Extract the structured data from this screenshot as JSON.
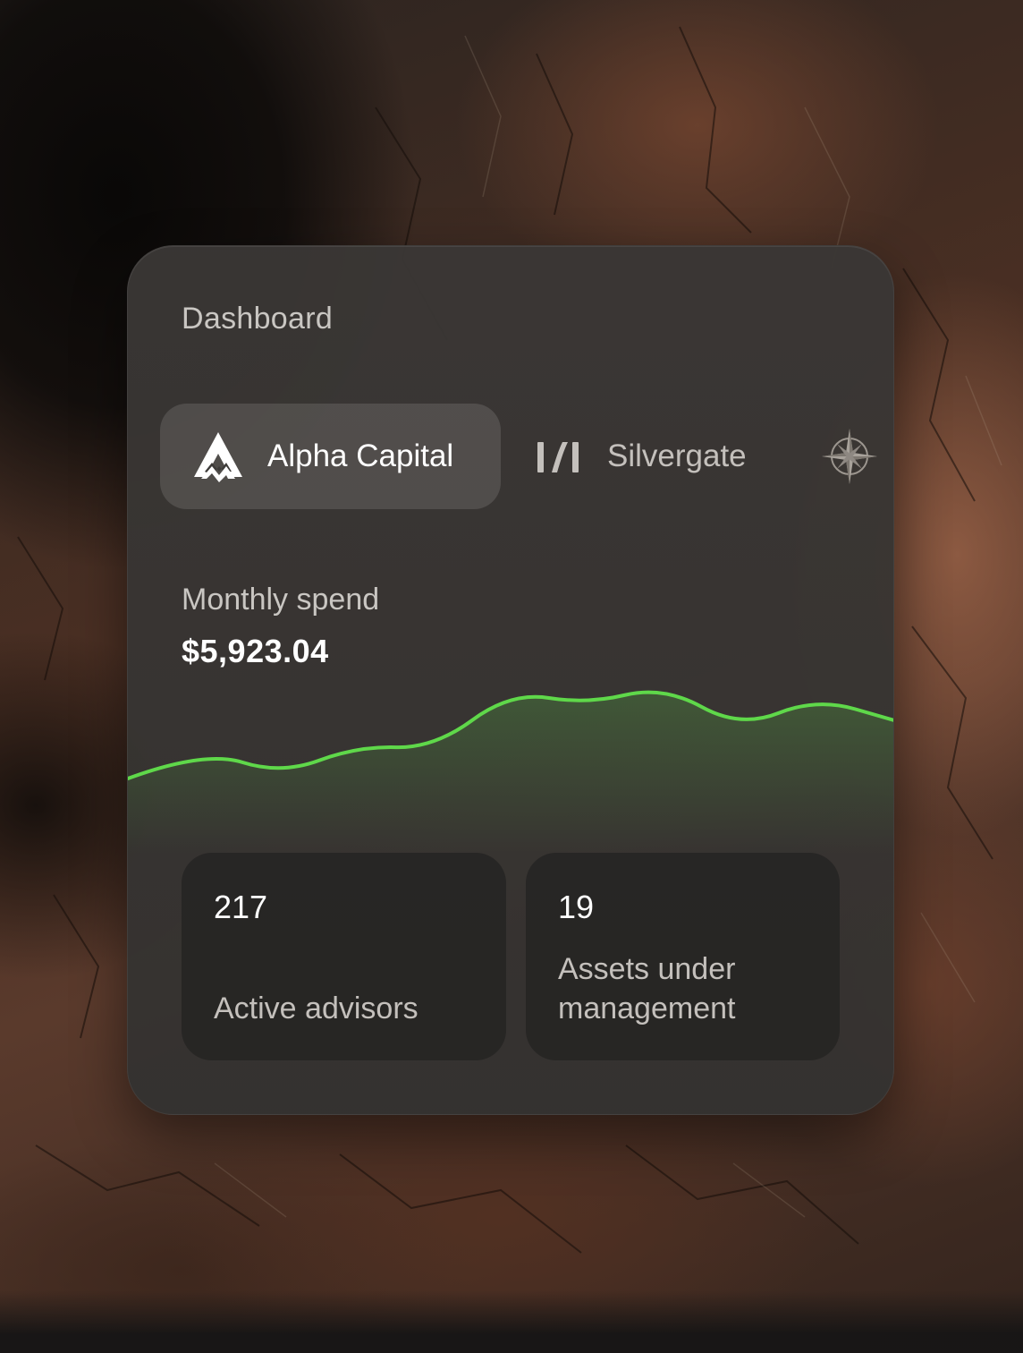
{
  "dashboard": {
    "title": "Dashboard"
  },
  "brands": [
    {
      "label": "Alpha Capital",
      "icon": "alpha-capital-logo-icon",
      "selected": true
    },
    {
      "label": "Silvergate",
      "icon": "silvergate-logo-icon",
      "selected": false
    },
    {
      "label": "",
      "icon": "compass-rose-logo-icon",
      "selected": false
    }
  ],
  "spend": {
    "label": "Monthly spend",
    "value": "$5,923.04"
  },
  "chart_data": {
    "type": "area",
    "values": [
      20,
      34,
      22,
      36,
      35,
      63,
      57,
      66,
      45,
      60,
      49
    ],
    "ylim": [
      0,
      80
    ],
    "line_color": "#5fd84a",
    "grid": false
  },
  "stats": [
    {
      "value": "217",
      "label": "Active advisors"
    },
    {
      "value": "19",
      "label": "Assets under management"
    }
  ]
}
